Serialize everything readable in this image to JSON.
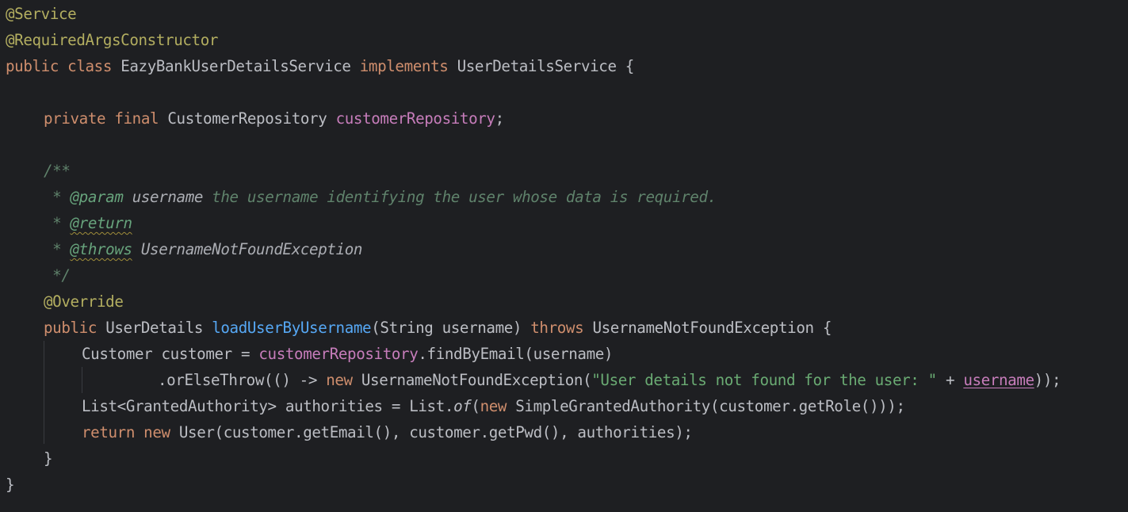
{
  "editor": {
    "lines": [
      {
        "indent": 0,
        "tokens": [
          {
            "t": "@Service",
            "c": "t-ann"
          }
        ]
      },
      {
        "indent": 0,
        "tokens": [
          {
            "t": "@RequiredArgsConstructor",
            "c": "t-ann"
          }
        ]
      },
      {
        "indent": 0,
        "tokens": [
          {
            "t": "public class ",
            "c": "t-kw"
          },
          {
            "t": "EazyBankUserDetailsService ",
            "c": "t-plain"
          },
          {
            "t": "implements ",
            "c": "t-kw"
          },
          {
            "t": "UserDetailsService {",
            "c": "t-plain"
          }
        ]
      },
      {
        "indent": 0,
        "tokens": []
      },
      {
        "indent": 1,
        "tokens": [
          {
            "t": "private final ",
            "c": "t-kw"
          },
          {
            "t": "CustomerRepository ",
            "c": "t-plain"
          },
          {
            "t": "customerRepository",
            "c": "t-fld"
          },
          {
            "t": ";",
            "c": "t-plain"
          }
        ]
      },
      {
        "indent": 0,
        "tokens": []
      },
      {
        "indent": 1,
        "tokens": [
          {
            "t": "/**",
            "c": "t-cmt"
          }
        ]
      },
      {
        "indent": 1,
        "tokens": [
          {
            "t": " * ",
            "c": "t-cmt"
          },
          {
            "t": "@param ",
            "c": "t-tag"
          },
          {
            "t": "username ",
            "c": "t-tagval"
          },
          {
            "t": "the username identifying the user whose data is required.",
            "c": "t-cmt"
          }
        ]
      },
      {
        "indent": 1,
        "tokens": [
          {
            "t": " * ",
            "c": "t-cmt"
          },
          {
            "t": "@return",
            "c": "t-tag t-warn"
          }
        ]
      },
      {
        "indent": 1,
        "tokens": [
          {
            "t": " * ",
            "c": "t-cmt"
          },
          {
            "t": "@throws",
            "c": "t-tag t-warn"
          },
          {
            "t": " UsernameNotFoundException",
            "c": "t-tagval"
          }
        ]
      },
      {
        "indent": 1,
        "tokens": [
          {
            "t": " */",
            "c": "t-cmt"
          }
        ]
      },
      {
        "indent": 1,
        "tokens": [
          {
            "t": "@Override",
            "c": "t-ann"
          }
        ]
      },
      {
        "indent": 1,
        "tokens": [
          {
            "t": "public ",
            "c": "t-kw"
          },
          {
            "t": "UserDetails ",
            "c": "t-plain"
          },
          {
            "t": "loadUserByUsername",
            "c": "t-fn"
          },
          {
            "t": "(String username) ",
            "c": "t-plain"
          },
          {
            "t": "throws ",
            "c": "t-kw"
          },
          {
            "t": "UsernameNotFoundException {",
            "c": "t-plain"
          }
        ]
      },
      {
        "indent": 2,
        "tokens": [
          {
            "t": "Customer customer = ",
            "c": "t-plain"
          },
          {
            "t": "customerRepository",
            "c": "t-fld"
          },
          {
            "t": ".findByEmail(username)",
            "c": "t-plain"
          }
        ]
      },
      {
        "indent": 4,
        "tokens": [
          {
            "t": ".orElseThrow(() -> ",
            "c": "t-plain"
          },
          {
            "t": "new ",
            "c": "t-kw"
          },
          {
            "t": "UsernameNotFoundException(",
            "c": "t-plain"
          },
          {
            "t": "\"User details not found for the user: \"",
            "c": "t-str"
          },
          {
            "t": " + ",
            "c": "t-plain"
          },
          {
            "t": "username",
            "c": "t-param-u"
          },
          {
            "t": "));",
            "c": "t-plain"
          }
        ]
      },
      {
        "indent": 2,
        "tokens": [
          {
            "t": "List<GrantedAuthority> authorities = List.",
            "c": "t-plain"
          },
          {
            "t": "of",
            "c": "t-static"
          },
          {
            "t": "(",
            "c": "t-plain"
          },
          {
            "t": "new ",
            "c": "t-kw"
          },
          {
            "t": "SimpleGrantedAuthority(customer.getRole()));",
            "c": "t-plain"
          }
        ]
      },
      {
        "indent": 2,
        "tokens": [
          {
            "t": "return new ",
            "c": "t-kw"
          },
          {
            "t": "User(customer.getEmail(), customer.getPwd(), authorities);",
            "c": "t-plain"
          }
        ]
      },
      {
        "indent": 1,
        "tokens": [
          {
            "t": "}",
            "c": "t-plain"
          }
        ]
      },
      {
        "indent": 0,
        "tokens": [
          {
            "t": "}",
            "c": "t-plain"
          }
        ]
      }
    ]
  }
}
